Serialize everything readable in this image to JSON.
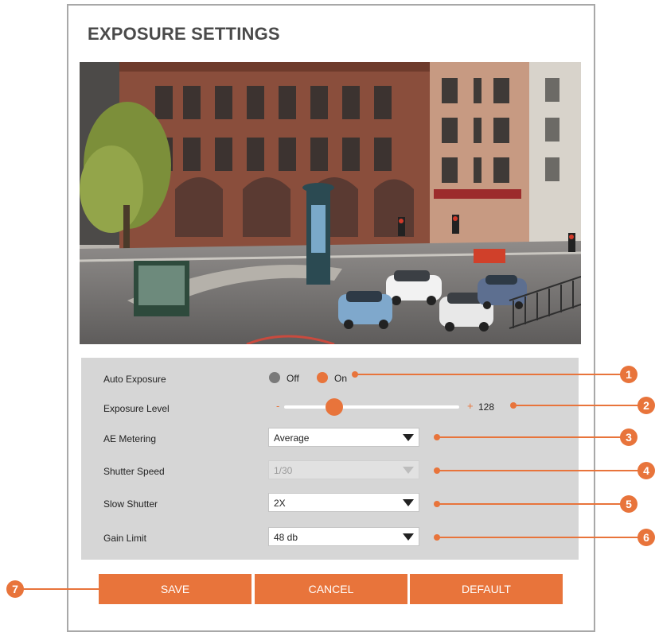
{
  "page": {
    "title": "EXPOSURE SETTINGS"
  },
  "colors": {
    "accent": "#e8743b",
    "panel": "#d6d6d6",
    "radio_off": "#7a7a7a"
  },
  "settings": {
    "auto_exposure": {
      "label": "Auto Exposure",
      "options": [
        "Off",
        "On"
      ],
      "selected": "On"
    },
    "exposure_level": {
      "label": "Exposure Level",
      "minus": "-",
      "plus": "+",
      "value": "128",
      "fraction": 0.25
    },
    "ae_metering": {
      "label": "AE Metering",
      "value": "Average"
    },
    "shutter_speed": {
      "label": "Shutter Speed",
      "value": "1/30",
      "disabled": true
    },
    "slow_shutter": {
      "label": "Slow Shutter",
      "value": "2X"
    },
    "gain_limit": {
      "label": "Gain Limit",
      "value": "48 db"
    }
  },
  "buttons": {
    "save": "SAVE",
    "cancel": "CANCEL",
    "default": "DEFAULT"
  },
  "callouts": [
    "1",
    "2",
    "3",
    "4",
    "5",
    "6",
    "7"
  ]
}
